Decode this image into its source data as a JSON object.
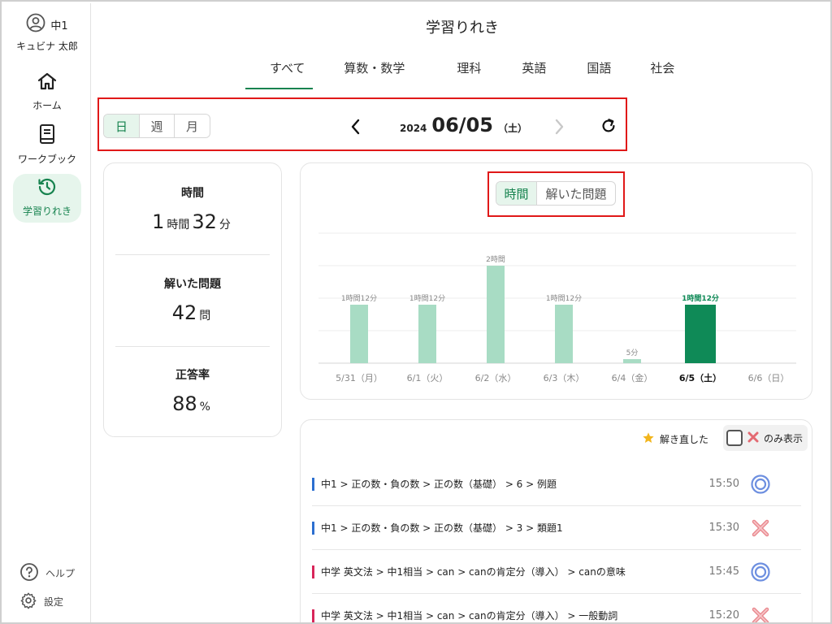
{
  "user": {
    "grade": "中1",
    "name": "キュビナ 太郎"
  },
  "sidebar": {
    "items": [
      {
        "label": "ホーム",
        "icon": "home-icon"
      },
      {
        "label": "ワークブック",
        "icon": "book-icon"
      },
      {
        "label": "学習りれき",
        "icon": "history-icon",
        "active": true
      }
    ],
    "help_label": "ヘルプ",
    "settings_label": "設定"
  },
  "header": {
    "title": "学習りれき"
  },
  "subject_tabs": [
    "すべて",
    "算数・数学",
    "理科",
    "英語",
    "国語",
    "社会"
  ],
  "active_subject": "すべて",
  "period": {
    "options": [
      "日",
      "週",
      "月"
    ],
    "selected": "日",
    "year": "2024",
    "date": "06/05",
    "weekday": "（土）"
  },
  "stats": {
    "time_label": "時間",
    "hours": "1",
    "hours_unit": "時間",
    "minutes": "32",
    "minutes_unit": "分",
    "solved_label": "解いた問題",
    "solved": "42",
    "solved_unit": "問",
    "accuracy_label": "正答率",
    "accuracy": "88",
    "accuracy_unit": "%"
  },
  "metric_toggle": {
    "options": [
      "時間",
      "解いた問題"
    ],
    "selected": "時間"
  },
  "chart_data": {
    "type": "bar",
    "categories": [
      "5/31（月）",
      "6/1（火）",
      "6/2（水）",
      "6/3（木）",
      "6/4（金）",
      "6/5（土）",
      "6/6（日）"
    ],
    "values_minutes": [
      72,
      72,
      120,
      72,
      5,
      72,
      0
    ],
    "labels": [
      "1時間12分",
      "1時間12分",
      "2時間",
      "1時間12分",
      "5分",
      "1時間12分",
      ""
    ],
    "selected_index": 5,
    "ylim_minutes": [
      0,
      160
    ],
    "grid": true,
    "colors": {
      "bar": "#a8dcc4",
      "selected": "#0f8a57"
    }
  },
  "list": {
    "redo_label": "解き直した",
    "filter_label": "のみ表示",
    "rows": [
      {
        "path": "中1 > 正の数・負の数 > 正の数（基礎） > 6 > 例題",
        "time": "15:50",
        "result": "correct",
        "subject_color": "#2c6fd0"
      },
      {
        "path": "中1 > 正の数・負の数 > 正の数（基礎） > 3 > 類題1",
        "time": "15:30",
        "result": "wrong",
        "subject_color": "#2c6fd0"
      },
      {
        "path": "中学 英文法 > 中1相当 > can > canの肯定分（導入） > canの意味",
        "time": "15:45",
        "result": "correct",
        "subject_color": "#d8265a"
      },
      {
        "path": "中学 英文法 > 中1相当 > can > canの肯定分（導入） > 一般動詞",
        "time": "15:20",
        "result": "wrong",
        "subject_color": "#d8265a"
      }
    ]
  }
}
